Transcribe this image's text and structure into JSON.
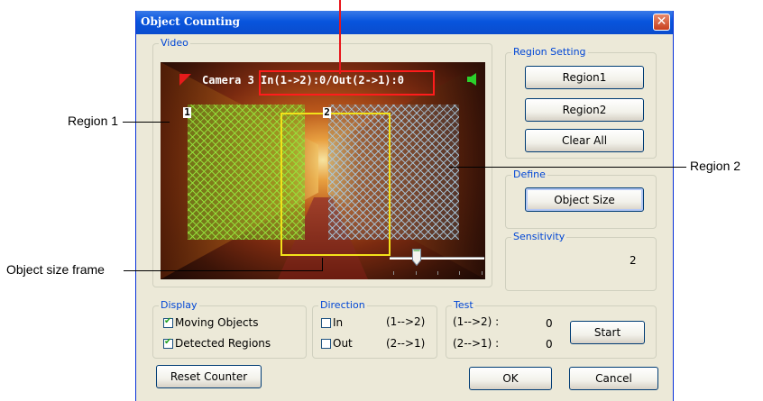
{
  "callouts": {
    "region1": "Region 1",
    "region2": "Region 2",
    "object_size_frame": "Object size frame"
  },
  "dialog": {
    "title": "Object Counting",
    "close_glyph": "✕"
  },
  "video": {
    "group_label": "Video",
    "osd_text": "Camera 3 In(1->2):0/Out(2->1):0",
    "region_labels": [
      "1",
      "2"
    ],
    "icons": [
      "record-flag-icon",
      "speaker-icon"
    ]
  },
  "region_setting": {
    "group_label": "Region Setting",
    "buttons": [
      "Region1",
      "Region2",
      "Clear All"
    ]
  },
  "define": {
    "group_label": "Define",
    "object_size_button": "Object Size"
  },
  "sensitivity": {
    "group_label": "Sensitivity",
    "value": "2"
  },
  "display": {
    "group_label": "Display",
    "moving_objects": {
      "label": "Moving Objects",
      "checked": true
    },
    "detected_regions": {
      "label": "Detected Regions",
      "checked": true
    }
  },
  "direction": {
    "group_label": "Direction",
    "in": {
      "label": "In",
      "arrow": "(1-->2)",
      "checked": false
    },
    "out": {
      "label": "Out",
      "arrow": "(2-->1)",
      "checked": false
    }
  },
  "test": {
    "group_label": "Test",
    "in_label": "(1-->2) :",
    "in_value": "0",
    "out_label": "(2-->1) :",
    "out_value": "0",
    "start_button": "Start"
  },
  "footer": {
    "reset_counter": "Reset Counter",
    "ok": "OK",
    "cancel": "Cancel"
  }
}
